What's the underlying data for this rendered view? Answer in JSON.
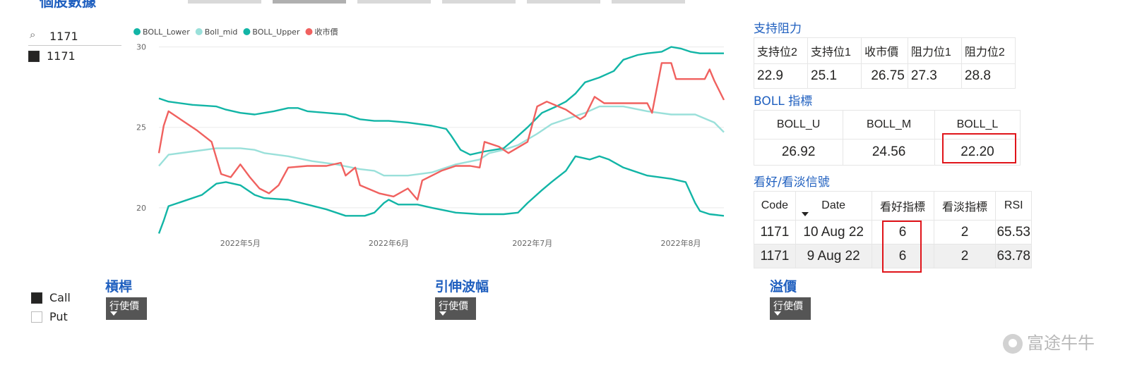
{
  "header": {
    "title": "個股數據",
    "tabs": [
      "",
      "",
      "",
      "",
      "",
      ""
    ]
  },
  "slicer": {
    "search_value": "1171",
    "selected_item": "1171"
  },
  "chart_data": {
    "type": "line",
    "title": "",
    "xlabel": "",
    "ylabel": "",
    "ylim": [
      17.5,
      30.2
    ],
    "y_ticks": [
      20,
      25,
      30
    ],
    "x_tick_labels": [
      {
        "label": "2022年5月",
        "day": 0
      },
      {
        "label": "2022年6月",
        "day": 31
      },
      {
        "label": "2022年7月",
        "day": 61
      },
      {
        "label": "2022年8月",
        "day": 92
      }
    ],
    "x_range_days": [
      -17,
      101
    ],
    "legend_position": "top-left",
    "series": [
      {
        "name": "BOLL_Lower",
        "color": "#12B5A6",
        "points": [
          [
            -17,
            18.4
          ],
          [
            -16,
            19.2
          ],
          [
            -15,
            20.1
          ],
          [
            -12,
            20.4
          ],
          [
            -8,
            20.8
          ],
          [
            -5,
            21.5
          ],
          [
            -3,
            21.6
          ],
          [
            0,
            21.4
          ],
          [
            3,
            20.8
          ],
          [
            5,
            20.6
          ],
          [
            10,
            20.5
          ],
          [
            14,
            20.2
          ],
          [
            18,
            19.9
          ],
          [
            22,
            19.5
          ],
          [
            26,
            19.5
          ],
          [
            28,
            19.7
          ],
          [
            30,
            20.3
          ],
          [
            31,
            20.5
          ],
          [
            33,
            20.2
          ],
          [
            37,
            20.2
          ],
          [
            40,
            20.0
          ],
          [
            45,
            19.7
          ],
          [
            50,
            19.6
          ],
          [
            55,
            19.6
          ],
          [
            58,
            19.7
          ],
          [
            60,
            20.3
          ],
          [
            63,
            21.1
          ],
          [
            65,
            21.6
          ],
          [
            68,
            22.3
          ],
          [
            70,
            23.2
          ],
          [
            73,
            23.0
          ],
          [
            75,
            23.2
          ],
          [
            77,
            23.0
          ],
          [
            80,
            22.5
          ],
          [
            85,
            22.0
          ],
          [
            90,
            21.8
          ],
          [
            93,
            21.6
          ],
          [
            95,
            20.3
          ],
          [
            96,
            19.8
          ],
          [
            98,
            19.6
          ],
          [
            101,
            19.5
          ]
        ]
      },
      {
        "name": "Boll_mid",
        "color": "#9AE0DA",
        "points": [
          [
            -17,
            22.6
          ],
          [
            -15,
            23.3
          ],
          [
            -10,
            23.5
          ],
          [
            -5,
            23.7
          ],
          [
            0,
            23.7
          ],
          [
            3,
            23.6
          ],
          [
            5,
            23.4
          ],
          [
            10,
            23.2
          ],
          [
            15,
            22.9
          ],
          [
            20,
            22.7
          ],
          [
            25,
            22.4
          ],
          [
            28,
            22.3
          ],
          [
            30,
            22.0
          ],
          [
            35,
            22.0
          ],
          [
            40,
            22.2
          ],
          [
            45,
            22.7
          ],
          [
            50,
            23.0
          ],
          [
            52,
            23.4
          ],
          [
            55,
            23.6
          ],
          [
            58,
            23.9
          ],
          [
            62,
            24.6
          ],
          [
            65,
            25.2
          ],
          [
            68,
            25.5
          ],
          [
            72,
            25.9
          ],
          [
            75,
            26.3
          ],
          [
            78,
            26.3
          ],
          [
            80,
            26.3
          ],
          [
            85,
            26.0
          ],
          [
            90,
            25.8
          ],
          [
            95,
            25.8
          ],
          [
            99,
            25.3
          ],
          [
            101,
            24.7
          ]
        ]
      },
      {
        "name": "BOLL_Upper",
        "color": "#12B5A6",
        "points": [
          [
            -17,
            26.8
          ],
          [
            -15,
            26.6
          ],
          [
            -10,
            26.4
          ],
          [
            -5,
            26.3
          ],
          [
            -3,
            26.1
          ],
          [
            0,
            25.9
          ],
          [
            3,
            25.8
          ],
          [
            5,
            25.9
          ],
          [
            7,
            26.0
          ],
          [
            10,
            26.2
          ],
          [
            12,
            26.2
          ],
          [
            14,
            26.0
          ],
          [
            18,
            25.9
          ],
          [
            22,
            25.8
          ],
          [
            25,
            25.5
          ],
          [
            28,
            25.4
          ],
          [
            31,
            25.4
          ],
          [
            35,
            25.3
          ],
          [
            40,
            25.1
          ],
          [
            43,
            24.9
          ],
          [
            44,
            24.5
          ],
          [
            46,
            23.6
          ],
          [
            48,
            23.3
          ],
          [
            51,
            23.5
          ],
          [
            55,
            23.7
          ],
          [
            57,
            24.2
          ],
          [
            60,
            25.0
          ],
          [
            63,
            25.9
          ],
          [
            66,
            26.3
          ],
          [
            68,
            26.6
          ],
          [
            70,
            27.1
          ],
          [
            72,
            27.8
          ],
          [
            75,
            28.1
          ],
          [
            78,
            28.5
          ],
          [
            80,
            29.2
          ],
          [
            83,
            29.5
          ],
          [
            85,
            29.6
          ],
          [
            88,
            29.7
          ],
          [
            90,
            30.0
          ],
          [
            92,
            29.9
          ],
          [
            94,
            29.7
          ],
          [
            96,
            29.6
          ],
          [
            101,
            29.6
          ]
        ]
      },
      {
        "name": "收市價",
        "color": "#F0615F",
        "points": [
          [
            -17,
            23.4
          ],
          [
            -16,
            25.1
          ],
          [
            -15,
            26.0
          ],
          [
            -12,
            25.4
          ],
          [
            -9,
            24.8
          ],
          [
            -6,
            24.1
          ],
          [
            -4,
            22.1
          ],
          [
            -2,
            21.9
          ],
          [
            0,
            22.7
          ],
          [
            2,
            21.9
          ],
          [
            4,
            21.2
          ],
          [
            6,
            20.9
          ],
          [
            8,
            21.4
          ],
          [
            10,
            22.5
          ],
          [
            14,
            22.6
          ],
          [
            18,
            22.6
          ],
          [
            21,
            22.8
          ],
          [
            22,
            22.0
          ],
          [
            24,
            22.5
          ],
          [
            25,
            21.4
          ],
          [
            29,
            20.9
          ],
          [
            32,
            20.7
          ],
          [
            35,
            21.2
          ],
          [
            37,
            20.5
          ],
          [
            38,
            21.7
          ],
          [
            42,
            22.3
          ],
          [
            45,
            22.6
          ],
          [
            48,
            22.6
          ],
          [
            50,
            22.5
          ],
          [
            51,
            24.1
          ],
          [
            54,
            23.8
          ],
          [
            56,
            23.4
          ],
          [
            60,
            24.1
          ],
          [
            62,
            26.3
          ],
          [
            64,
            26.6
          ],
          [
            68,
            26.1
          ],
          [
            71,
            25.5
          ],
          [
            72,
            25.7
          ],
          [
            74,
            26.9
          ],
          [
            76,
            26.5
          ],
          [
            80,
            26.5
          ],
          [
            82,
            26.5
          ],
          [
            85,
            26.5
          ],
          [
            86,
            25.9
          ],
          [
            88,
            29.0
          ],
          [
            90,
            29.0
          ],
          [
            91,
            28.0
          ],
          [
            94,
            28.0
          ],
          [
            97,
            28.0
          ],
          [
            98,
            28.6
          ],
          [
            99,
            27.9
          ],
          [
            101,
            26.7
          ]
        ]
      }
    ]
  },
  "support_resistance": {
    "title": "支持阻力",
    "headers": [
      "支持位2",
      "支持位1",
      "收市價",
      "阻力位1",
      "阻力位2"
    ],
    "values": [
      "22.9",
      "25.1",
      "26.75",
      "27.3",
      "28.8"
    ]
  },
  "boll": {
    "title": "BOLL 指標",
    "headers": [
      "BOLL_U",
      "BOLL_M",
      "BOLL_L"
    ],
    "values": [
      "26.92",
      "24.56",
      "22.20"
    ]
  },
  "signals": {
    "title": "看好/看淡信號",
    "headers": [
      "Code",
      "Date",
      "看好指標",
      "看淡指標",
      "RSI"
    ],
    "rows": [
      [
        "1171",
        "10 Aug 22",
        "6",
        "2",
        "65.53"
      ],
      [
        "1171",
        "9 Aug 22",
        "6",
        "2",
        "63.78"
      ]
    ]
  },
  "option_legend": {
    "call": "Call",
    "put": "Put"
  },
  "sections": {
    "leverage": "槓桿",
    "implied_vol": "引伸波幅",
    "premium": "溢價"
  },
  "dropdown_label": "行使價",
  "watermark": "富途牛牛"
}
